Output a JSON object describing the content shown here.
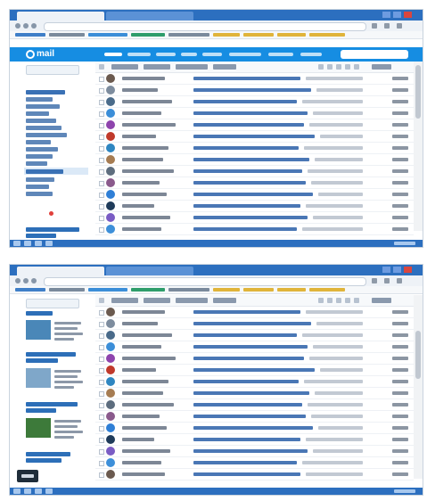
{
  "browser": {
    "tabs": [],
    "url": ""
  },
  "mail": {
    "logo_text": "mail",
    "nav_items": [],
    "search_placeholder": "",
    "compose_label": "",
    "folders": [],
    "toolbar_labels": [],
    "messages": [],
    "promos": []
  },
  "colors": {
    "browser_chrome": "#2c6fbf",
    "mail_header": "#168de2",
    "link_blue": "#4a77b5",
    "accent_red": "#e0403b"
  },
  "avatar_colors": [
    "#6b5a4f",
    "#7d8c9e",
    "#4a6b8a",
    "#3b8ed8",
    "#8e44ad",
    "#c0392b",
    "#2e86c1",
    "#a67c52",
    "#5d6d7e",
    "#8a5a8c",
    "#2f7fd6",
    "#1f3b5a",
    "#7a5cc4",
    "#3d8fd9"
  ],
  "icons": [
    "mail-logo-icon",
    "back-icon",
    "forward-icon",
    "reload-icon",
    "home-icon",
    "star-icon",
    "extension-icon",
    "search-icon",
    "avatar-icon",
    "close-icon",
    "minimize-icon",
    "maximize-icon"
  ]
}
